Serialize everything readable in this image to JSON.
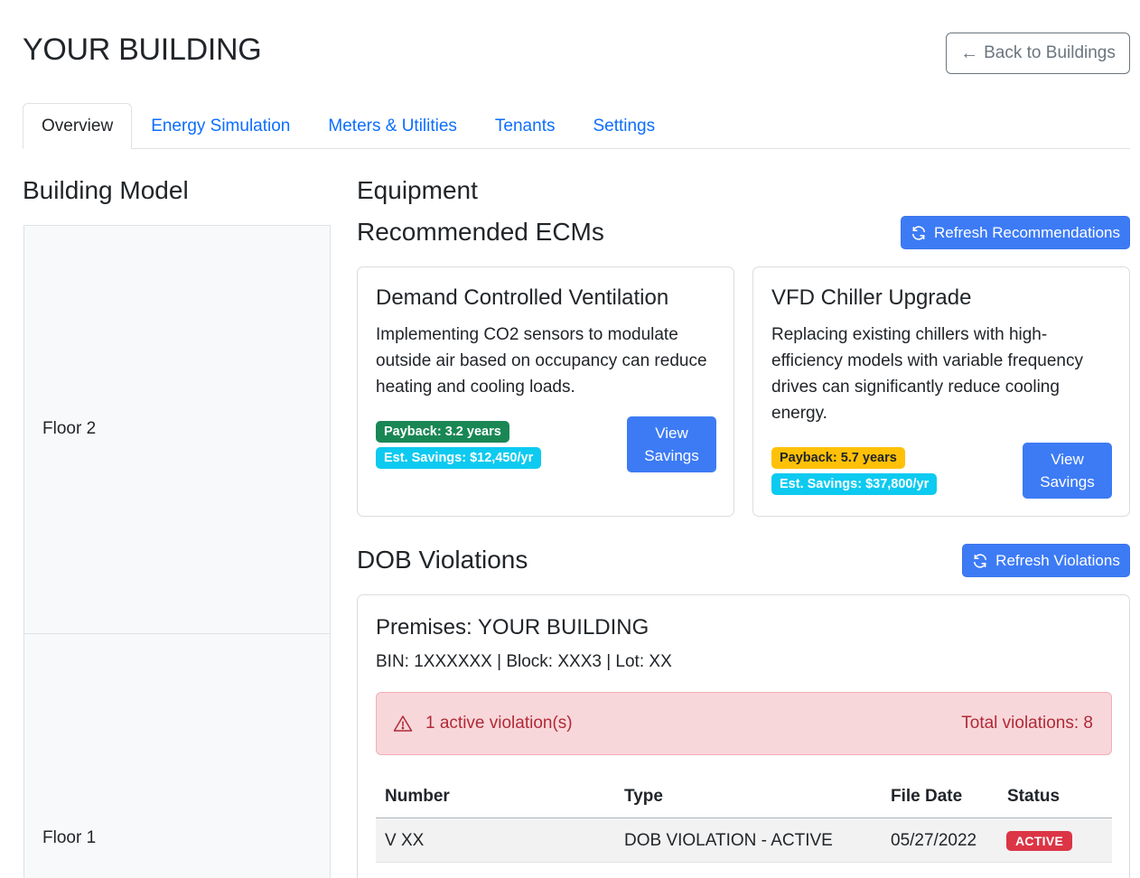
{
  "header": {
    "title": "YOUR BUILDING",
    "back_label": "Back to Buildings",
    "back_arrow": "←"
  },
  "tabs": [
    {
      "label": "Overview",
      "active": true
    },
    {
      "label": "Energy Simulation",
      "active": false
    },
    {
      "label": "Meters & Utilities",
      "active": false
    },
    {
      "label": "Tenants",
      "active": false
    },
    {
      "label": "Settings",
      "active": false
    }
  ],
  "building_model": {
    "heading": "Building Model",
    "floors": [
      "Floor 2",
      "Floor 1"
    ]
  },
  "equipment": {
    "heading": "Equipment"
  },
  "ecms": {
    "heading": "Recommended ECMs",
    "refresh_label": "Refresh Recommendations",
    "cards": [
      {
        "title": "Demand Controlled Ventilation",
        "description": "Implementing CO2 sensors to modulate outside air based on occupancy can reduce heating and cooling loads.",
        "payback": "Payback: 3.2 years",
        "savings": "Est. Savings: $12,450/yr",
        "view_line1": "View",
        "view_line2": "Savings"
      },
      {
        "title": "VFD Chiller Upgrade",
        "description": "Replacing existing chillers with high-efficiency models with variable frequency drives can significantly reduce cooling energy.",
        "payback": "Payback: 5.7 years",
        "savings": "Est. Savings: $37,800/yr",
        "view_line1": "View",
        "view_line2": "Savings"
      }
    ]
  },
  "violations": {
    "heading": "DOB Violations",
    "refresh_label": "Refresh Violations",
    "premises": "Premises: YOUR BUILDING",
    "meta": "BIN: 1XXXXXX | Block: XXX3 | Lot: XX",
    "alert_active": "1 active violation(s)",
    "alert_total": "Total violations: 8",
    "columns": [
      "Number",
      "Type",
      "File Date",
      "Status"
    ],
    "rows": [
      {
        "number": "V XX",
        "type": "DOB VIOLATION - ACTIVE",
        "file_date": "05/27/2022",
        "status": "ACTIVE"
      }
    ]
  },
  "colors": {
    "primary": "#3d7bf5",
    "link": "#0d6efd",
    "success": "#198754",
    "info": "#0dcaf0",
    "warning": "#ffc107",
    "danger": "#dc3545"
  }
}
